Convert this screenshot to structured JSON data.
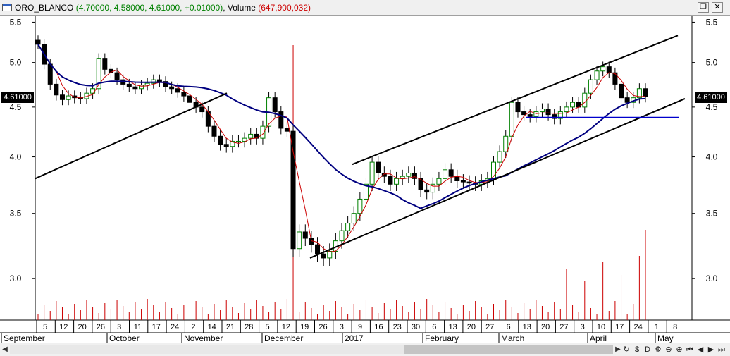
{
  "window": {
    "symbol": "ORO_BLANCO",
    "ohlc": "(4.70000, 4.58000, 4.61000, +0.01000)",
    "volume_label": "Volume",
    "volume_value": "(647,900,032)",
    "restore_icon": "restore-window-icon",
    "close_icon": "close-window-icon"
  },
  "price_label": "4.61000",
  "chart_data": {
    "type": "candlestick",
    "y_ticks": [
      5.5,
      5.0,
      4.5,
      4.0,
      3.5,
      3.0
    ],
    "y_tick_labels": [
      "5.5",
      "5.0",
      "4.5",
      "4.0",
      "3.5",
      "3.0"
    ],
    "ylim": [
      2.72,
      5.55
    ],
    "last_price": 4.61,
    "day_labels": [
      "5",
      "12",
      "20",
      "26",
      "3",
      "11",
      "17",
      "24",
      "2",
      "14",
      "21",
      "28",
      "5",
      "12",
      "19",
      "26",
      "3",
      "9",
      "16",
      "23",
      "30",
      "6",
      "13",
      "20",
      "27",
      "6",
      "13",
      "20",
      "27",
      "3",
      "10",
      "17",
      "24",
      "1",
      "8"
    ],
    "month_labels": [
      "September",
      "October",
      "November",
      "December",
      "2017",
      "February",
      "March",
      "April",
      "May"
    ],
    "close_prices": [
      5.22,
      4.98,
      4.75,
      4.63,
      4.58,
      4.62,
      4.6,
      4.59,
      4.65,
      4.7,
      5.05,
      4.92,
      4.88,
      4.8,
      4.75,
      4.72,
      4.7,
      4.74,
      4.76,
      4.8,
      4.78,
      4.72,
      4.7,
      4.66,
      4.62,
      4.55,
      4.5,
      4.45,
      4.3,
      4.2,
      4.12,
      4.1,
      4.15,
      4.15,
      4.18,
      4.22,
      4.18,
      4.3,
      4.6,
      4.45,
      4.28,
      4.25,
      3.22,
      3.35,
      3.3,
      3.25,
      3.18,
      3.15,
      3.2,
      3.28,
      3.36,
      3.42,
      3.5,
      3.62,
      3.75,
      3.95,
      3.85,
      3.82,
      3.75,
      3.8,
      3.82,
      3.85,
      3.8,
      3.7,
      3.68,
      3.75,
      3.8,
      3.88,
      3.82,
      3.78,
      3.77,
      3.76,
      3.75,
      3.78,
      3.8,
      3.95,
      4.05,
      4.2,
      4.55,
      4.45,
      4.42,
      4.4,
      4.45,
      4.48,
      4.42,
      4.38,
      4.45,
      4.5,
      4.55,
      4.5,
      4.65,
      4.8,
      4.9,
      4.95,
      4.88,
      4.75,
      4.6,
      4.55,
      4.6,
      4.7,
      4.61
    ],
    "volume_tall_idx": [
      42,
      100
    ],
    "series": [
      {
        "name": "",
        "color": "#cc0000"
      },
      {
        "name": "",
        "color": "#000080"
      }
    ]
  }
}
